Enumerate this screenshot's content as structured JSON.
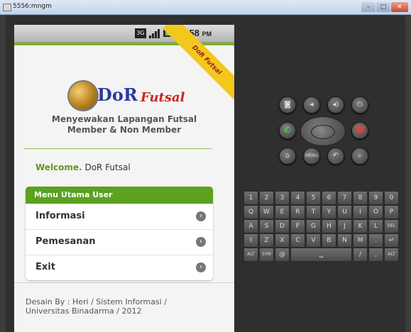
{
  "window": {
    "title": "5556:mngm",
    "min": "–",
    "max": "□",
    "close": "✕"
  },
  "status": {
    "network": "3G",
    "time": "7:58",
    "ampm": "PM"
  },
  "ribbon": "DoR Futsal",
  "logo": {
    "dor": "DoR",
    "futsal": "Futsal"
  },
  "tagline": {
    "line1": "Menyewakan Lapangan Futsal",
    "line2": "Member & Non Member"
  },
  "welcome": {
    "prefix": "Welcome.",
    "name": "DoR Futsal"
  },
  "menu": {
    "header": "Menu Utama User",
    "items": [
      {
        "label": "Informasi"
      },
      {
        "label": "Pemesanan"
      },
      {
        "label": "Exit"
      }
    ]
  },
  "footer": {
    "line1": "Desain By : Heri / Sistem Informasi /",
    "line2": "Universitas Binadarma / 2012"
  },
  "emulator": {
    "camera": "camera-icon",
    "vol_down": "volume-down-icon",
    "vol_up": "volume-up-icon",
    "power": "power-icon",
    "call": "call-icon",
    "end": "end-call-icon",
    "home": "home-icon",
    "menu": "MENU",
    "back": "back-icon",
    "search": "search-icon"
  },
  "keyboard": {
    "row1": [
      "1",
      "2",
      "3",
      "4",
      "5",
      "6",
      "7",
      "8",
      "9",
      "0"
    ],
    "row2": [
      "Q",
      "W",
      "E",
      "R",
      "T",
      "Y",
      "U",
      "I",
      "O",
      "P"
    ],
    "row3": [
      "A",
      "S",
      "D",
      "F",
      "G",
      "H",
      "J",
      "K",
      "L",
      "DEL"
    ],
    "row4": [
      "⇧",
      "Z",
      "X",
      "C",
      "V",
      "B",
      "N",
      "M",
      ".",
      "↵"
    ],
    "row5": [
      "ALT",
      "SYM",
      "@",
      "␣",
      "/",
      ",",
      "ALT"
    ]
  }
}
